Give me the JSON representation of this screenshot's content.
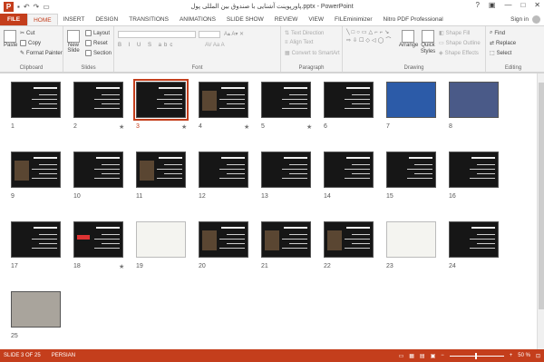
{
  "window": {
    "title": "پاورپوینت آشنایی با صندوق بین المللی پول.pptx - PowerPoint",
    "signin": "Sign in"
  },
  "tabs": [
    "FILE",
    "HOME",
    "INSERT",
    "DESIGN",
    "TRANSITIONS",
    "ANIMATIONS",
    "SLIDE SHOW",
    "REVIEW",
    "VIEW",
    "FILEminimizer",
    "Nitro PDF Professional"
  ],
  "active_tab": "HOME",
  "ribbon": {
    "clipboard": {
      "label": "Clipboard",
      "paste": "Paste",
      "cut": "Cut",
      "copy": "Copy",
      "format_painter": "Format Painter"
    },
    "slides": {
      "label": "Slides",
      "new_slide": "New Slide",
      "layout": "Layout",
      "reset": "Reset",
      "section": "Section"
    },
    "font": {
      "label": "Font"
    },
    "paragraph": {
      "label": "Paragraph",
      "text_direction": "Text Direction",
      "align_text": "Align Text",
      "convert": "Convert to SmartArt"
    },
    "drawing": {
      "label": "Drawing",
      "arrange": "Arrange",
      "quick_styles": "Quick Styles",
      "shape_fill": "Shape Fill",
      "shape_outline": "Shape Outline",
      "shape_effects": "Shape Effects"
    },
    "editing": {
      "label": "Editing",
      "find": "Find",
      "replace": "Replace",
      "select": "Select"
    }
  },
  "slides": [
    {
      "n": "1",
      "star": false,
      "style": "title"
    },
    {
      "n": "2",
      "star": true,
      "style": "text"
    },
    {
      "n": "3",
      "star": true,
      "style": "text",
      "selected": true
    },
    {
      "n": "4",
      "star": true,
      "style": "photo"
    },
    {
      "n": "5",
      "star": true,
      "style": "text"
    },
    {
      "n": "6",
      "star": false,
      "style": "text"
    },
    {
      "n": "7",
      "star": false,
      "style": "blue"
    },
    {
      "n": "8",
      "star": false,
      "style": "crowd"
    },
    {
      "n": "9",
      "star": false,
      "style": "photo"
    },
    {
      "n": "10",
      "star": false,
      "style": "text"
    },
    {
      "n": "11",
      "star": false,
      "style": "photo"
    },
    {
      "n": "12",
      "star": false,
      "style": "text"
    },
    {
      "n": "13",
      "star": false,
      "style": "text"
    },
    {
      "n": "14",
      "star": false,
      "style": "text"
    },
    {
      "n": "15",
      "star": false,
      "style": "text"
    },
    {
      "n": "16",
      "star": false,
      "style": "text"
    },
    {
      "n": "17",
      "star": false,
      "style": "text"
    },
    {
      "n": "18",
      "star": true,
      "style": "redtext"
    },
    {
      "n": "19",
      "star": false,
      "style": "light"
    },
    {
      "n": "20",
      "star": false,
      "style": "photo"
    },
    {
      "n": "21",
      "star": false,
      "style": "photo"
    },
    {
      "n": "22",
      "star": false,
      "style": "photo"
    },
    {
      "n": "23",
      "star": false,
      "style": "light"
    },
    {
      "n": "24",
      "star": false,
      "style": "text"
    },
    {
      "n": "25",
      "star": false,
      "style": "office"
    }
  ],
  "status": {
    "slide_count": "SLIDE 3 OF 25",
    "language": "PERSIAN",
    "zoom": "50 %"
  }
}
